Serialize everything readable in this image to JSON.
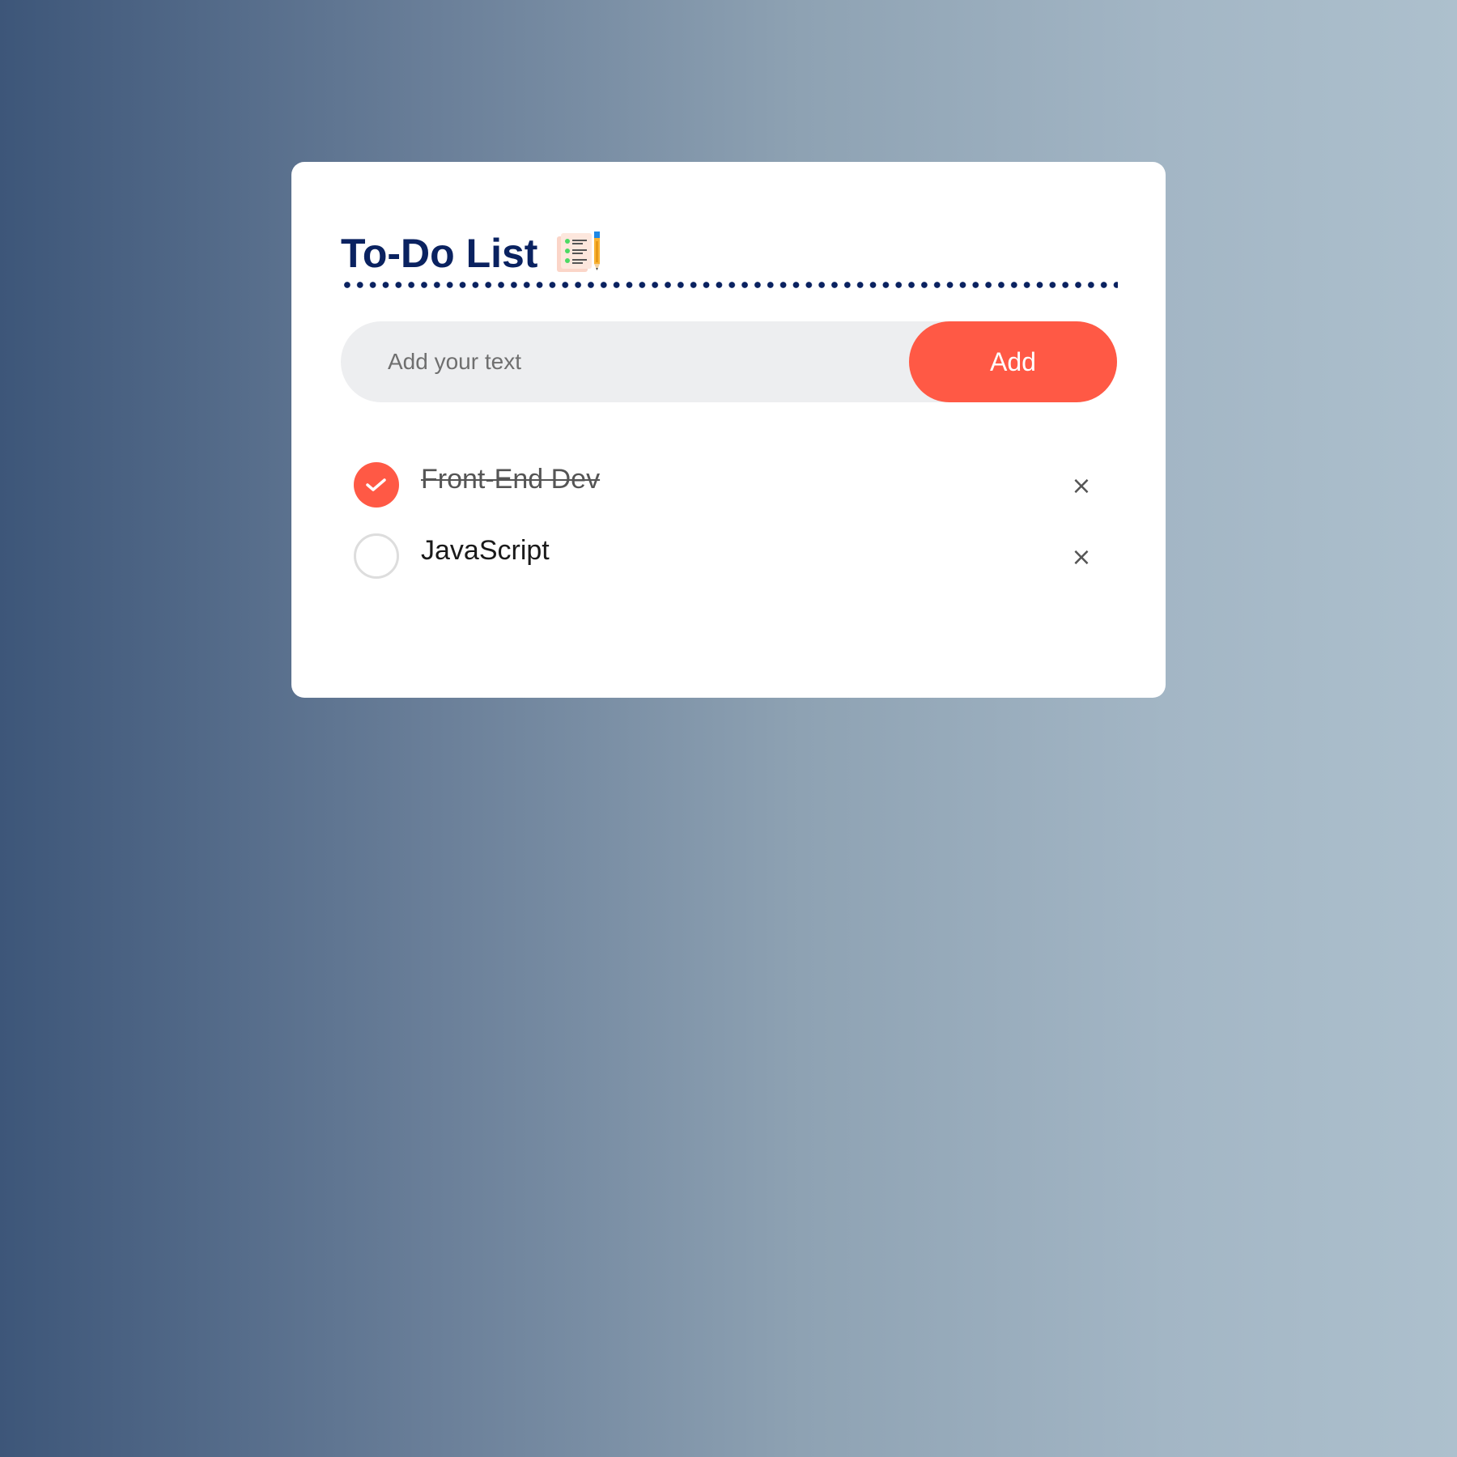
{
  "app": {
    "title": "To-Do List"
  },
  "input": {
    "placeholder": "Add your text",
    "value": ""
  },
  "add_button": {
    "label": "Add"
  },
  "todos": [
    {
      "text": "Front-End Dev",
      "completed": true,
      "remove_icon": "×"
    },
    {
      "text": "JavaScript",
      "completed": false,
      "remove_icon": "×"
    }
  ],
  "icons": {
    "title_icon": "notes-pencil-icon",
    "check_icon": "checkmark-icon",
    "remove_icon": "close-icon"
  },
  "colors": {
    "accent": "#ff5945",
    "title": "#0a2260",
    "input_bg": "#edeef0"
  }
}
